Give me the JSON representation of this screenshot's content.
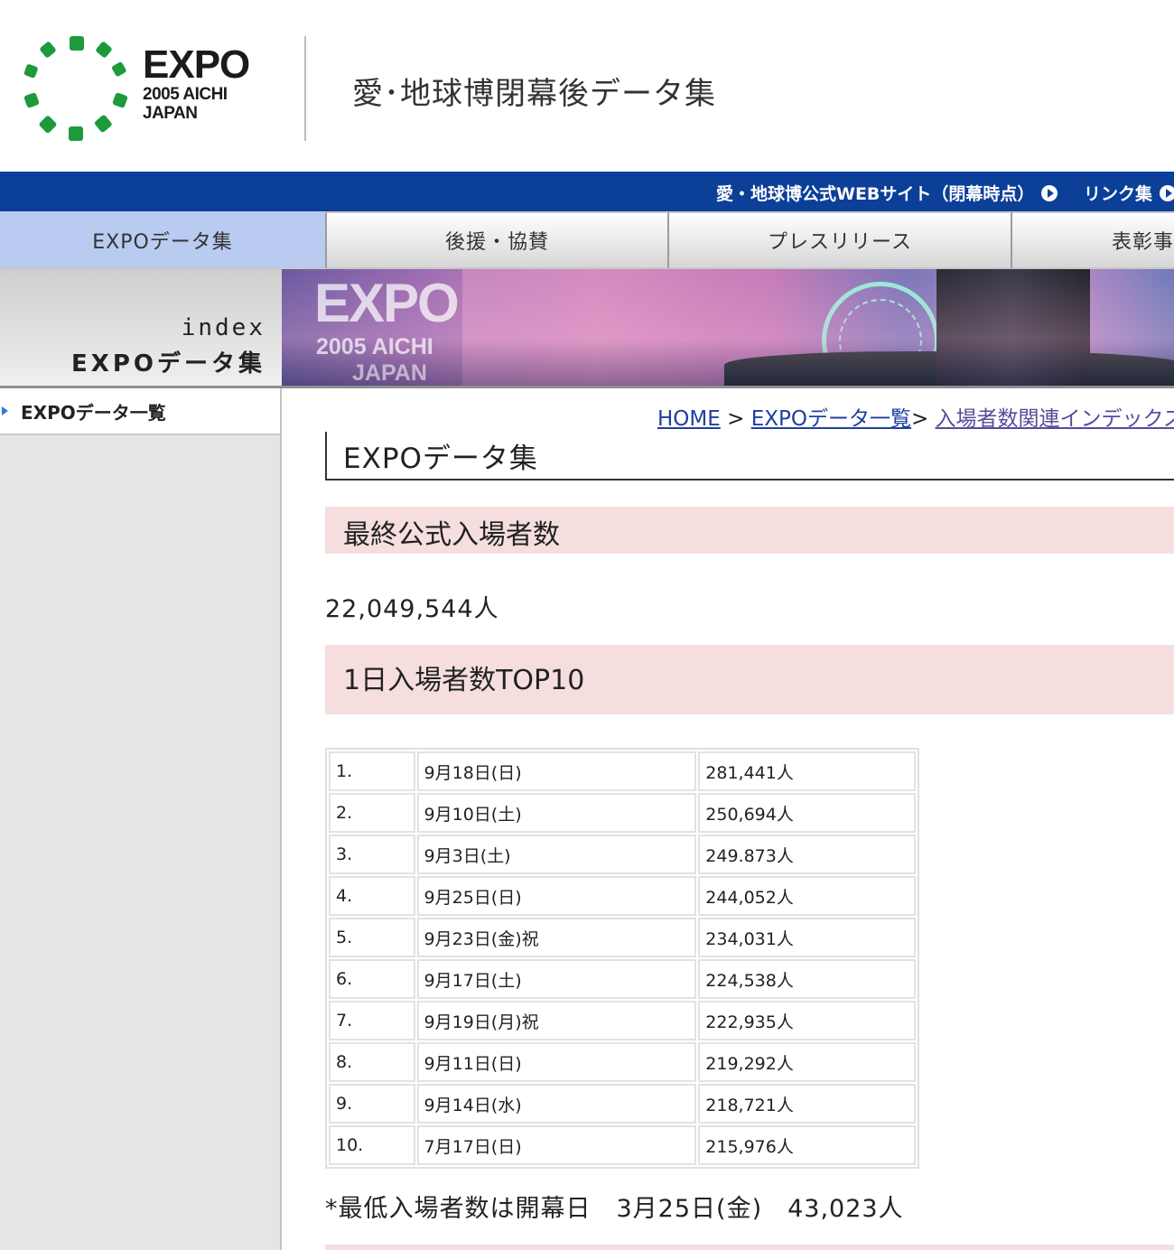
{
  "header": {
    "logo": {
      "title": "EXPO",
      "sub1": "2005 AICHI",
      "sub2": "JAPAN"
    },
    "site_title": "愛･地球博閉幕後データ集"
  },
  "topnav": {
    "links": [
      {
        "label": "愛・地球博公式WEBサイト（閉幕時点）"
      },
      {
        "label": "リンク集"
      }
    ]
  },
  "tabs": [
    {
      "label": "EXPOデータ集",
      "active": true
    },
    {
      "label": "後援・協賛"
    },
    {
      "label": "プレスリリース"
    },
    {
      "label": "表彰事"
    }
  ],
  "banner": {
    "line1": "index",
    "line2": "EXPOデータ集",
    "photo_title": "EXPO",
    "photo_sub1": "2005 AICHI",
    "photo_sub2": "JAPAN"
  },
  "sidebar": {
    "items": [
      {
        "label": "EXPOデータ一覧"
      }
    ]
  },
  "breadcrumb": {
    "home": "HOME",
    "sep1": " > ",
    "list": "EXPOデータ一覧",
    "sep2": "> ",
    "current": "入場者数関連インデックス"
  },
  "main": {
    "heading": "EXPOデータ集",
    "section1": "最終公式入場者数",
    "total": "22,049,544人",
    "section2": "1日入場者数TOP10",
    "top10": [
      {
        "rank": "1.",
        "date": "9月18日(日)",
        "count": "281,441人"
      },
      {
        "rank": "2.",
        "date": "9月10日(土)",
        "count": "250,694人"
      },
      {
        "rank": "3.",
        "date": "9月3日(土)",
        "count": "249.873人"
      },
      {
        "rank": "4.",
        "date": "9月25日(日)",
        "count": "244,052人"
      },
      {
        "rank": "5.",
        "date": "9月23日(金)祝",
        "count": "234,031人"
      },
      {
        "rank": "6.",
        "date": "9月17日(土)",
        "count": "224,538人"
      },
      {
        "rank": "7.",
        "date": "9月19日(月)祝",
        "count": "222,935人"
      },
      {
        "rank": "8.",
        "date": "9月11日(日)",
        "count": "219,292人"
      },
      {
        "rank": "9.",
        "date": "9月14日(水)",
        "count": "218,721人"
      },
      {
        "rank": "10.",
        "date": "7月17日(日)",
        "count": "215,976人"
      }
    ],
    "note": "*最低入場者数は開幕日　3月25日(金)　43,023人"
  },
  "colors": {
    "nav_blue": "#0b3f98",
    "active_tab": "#b9cbf0",
    "section_pink": "#f6dede",
    "logo_green": "#1e9a3c"
  }
}
